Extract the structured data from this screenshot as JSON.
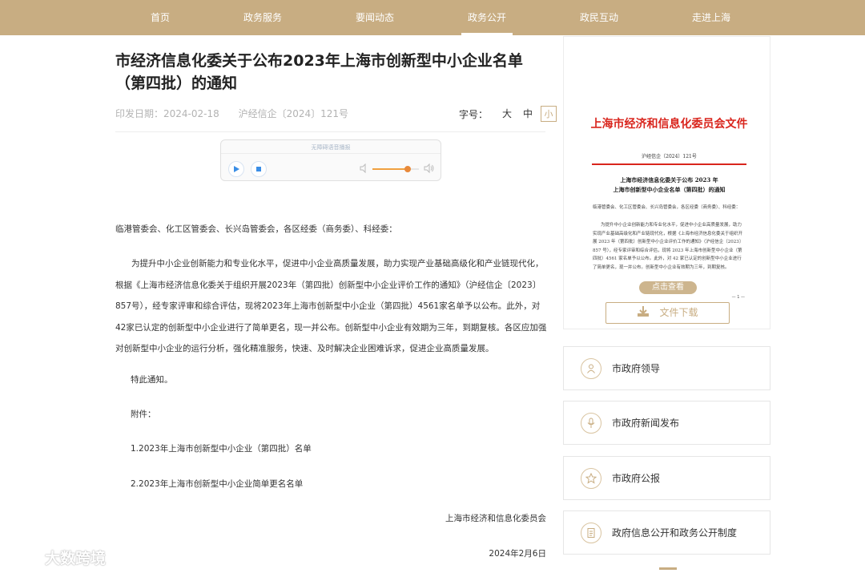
{
  "nav": {
    "items": [
      {
        "label": "首页"
      },
      {
        "label": "政务服务"
      },
      {
        "label": "要闻动态"
      },
      {
        "label": "政务公开",
        "active": true
      },
      {
        "label": "政民互动"
      },
      {
        "label": "走进上海"
      }
    ]
  },
  "colors": {
    "accent": "#c8ad82",
    "doc_red": "#d9251d"
  },
  "article": {
    "title": "市经济信息化委关于公布2023年上海市创新型中小企业名单（第四批）的通知",
    "publish_date": "印发日期：2024-02-18",
    "doc_number": "沪经信企〔2024〕121号",
    "font_size": {
      "label": "字号：",
      "options": [
        "大",
        "中",
        "小"
      ],
      "selected": "小"
    },
    "audio": {
      "title": "无障碍语音播报",
      "volume": 0.75
    },
    "addressee": "临港管委会、化工区管委会、长兴岛管委会，各区经委（商务委）、科经委：",
    "body": "为提升中小企业创新能力和专业化水平，促进中小企业高质量发展，助力实现产业基础高级化和产业链现代化，根据《上海市经济信息化委关于组织开展2023年（第四批）创新型中小企业评价工作的通知》（沪经信企〔2023〕857号），经专家评审和综合评估，现将2023年上海市创新型中小企业（第四批）4561家名单予以公布。此外，对42家已认定的创新型中小企业进行了简单更名，现一并公布。创新型中小企业有效期为三年，到期复核。各区应加强对创新型中小企业的运行分析，强化精准服务，快速、及时解决企业困难诉求，促进企业高质量发展。",
    "notice": "特此通知。",
    "attachments_label": "附件：",
    "attachments": [
      "1.2023年上海市创新型中小企业（第四批）名单",
      "2.2023年上海市创新型中小企业简单更名名单"
    ],
    "issuer": "上海市经济和信息化委员会",
    "date": "2024年2月6日"
  },
  "doc_preview": {
    "header": "上海市经济和信息化委员会文件",
    "number": "沪经信企〔2024〕121号",
    "title_line1": "上海市经济信息化委关于公布 2023 年",
    "title_line2": "上海市创新型中小企业名单（第四批）的通知",
    "addressee": "临港管委会、化工区管委会、长兴岛管委会，各区经委（商务委）、科经委：",
    "body": "为提升中小企业创新能力和专业化水平，促进中小企业高质量发展，助力实现产业基础高级化和产业链现代化，根据《上海市经济信息化委关于组织开展 2023 年（第四批）创新型中小企业评价工作的通知》（沪经信企〔2023〕857 号），经专家评审和综合评估，现将 2023 年上海市创新型中小企业（第四批）4561 家名单予以公布。此外，对 42 家已认定的创新型中小企业进行了简单更名，现一并公布。创新型中小企业有效期为三年，到期复核。",
    "page": "— 1 —",
    "view_label": "点击查看",
    "download_label": "文件下载"
  },
  "sidebar_links": [
    {
      "label": "市政府领导",
      "icon": "leader-icon"
    },
    {
      "label": "市政府新闻发布",
      "icon": "microphone-icon"
    },
    {
      "label": "市政府公报",
      "icon": "star-icon"
    },
    {
      "label": "政府信息公开和政务公开制度",
      "icon": "document-icon"
    }
  ],
  "watermark": {
    "text": "大数跨境"
  }
}
